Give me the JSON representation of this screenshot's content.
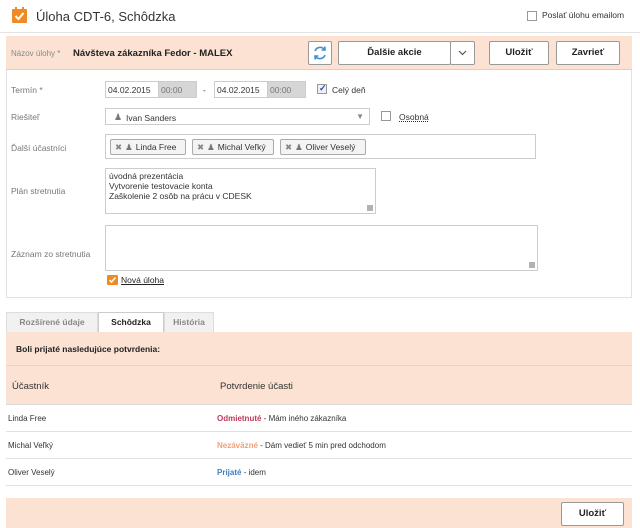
{
  "window": {
    "title": "Úloha CDT-6, Schôdzka",
    "email_label": "Poslať úlohu emailom"
  },
  "task": {
    "name_label": "Názov úlohy *",
    "name_value": "Návšteva zákazníka Fedor - MALEX",
    "more_actions": "Ďalšie akcie",
    "save": "Uložiť",
    "close": "Zavrieť"
  },
  "form": {
    "term_label": "Termín *",
    "date_from": "04.02.2015",
    "time_from": "00:00",
    "dash": "-",
    "date_to": "04.02.2015",
    "time_to": "00:00",
    "all_day_label": "Celý deň",
    "solver_label": "Riešiteľ",
    "solver_value": "Ivan Sanders",
    "personal_label": "Osobná",
    "participants_label": "Ďalší účastníci",
    "participants": [
      "Linda Free",
      "Michal Veľký",
      "Oliver Veselý"
    ],
    "plan_label": "Plán stretnutia",
    "plan_lines": [
      "úvodná prezentácia",
      "Vytvorenie testovacie konta",
      "Zaškolenie 2 osôb na prácu v CDESK"
    ],
    "record_label": "Záznam zo stretnutia",
    "new_task_link": "Nová úloha"
  },
  "tabs": [
    "Rozšírené údaje",
    "Schôdzka",
    "História"
  ],
  "confirmations": {
    "title": "Boli prijaté nasledujúce potvrdenia:",
    "col_participant": "Účastník",
    "col_confirmation": "Potvrdenie účasti",
    "rows": [
      {
        "name": "Linda Free",
        "status": "Odmietnuté",
        "status_color": "#c0395a",
        "note": " - Mám iného zákazníka"
      },
      {
        "name": "Michal Veľký",
        "status": "Nezáväzné",
        "status_color": "#f0a07a",
        "note": " - Dám vedieť 5 min pred odchodom"
      },
      {
        "name": "Oliver Veselý",
        "status": "Prijaté",
        "status_color": "#3d7fc4",
        "note": " - idem"
      }
    ]
  },
  "footer": {
    "save": "Uložiť"
  },
  "colors": {
    "accent": "#f08a24",
    "header_bg": "#fbe2d3"
  }
}
